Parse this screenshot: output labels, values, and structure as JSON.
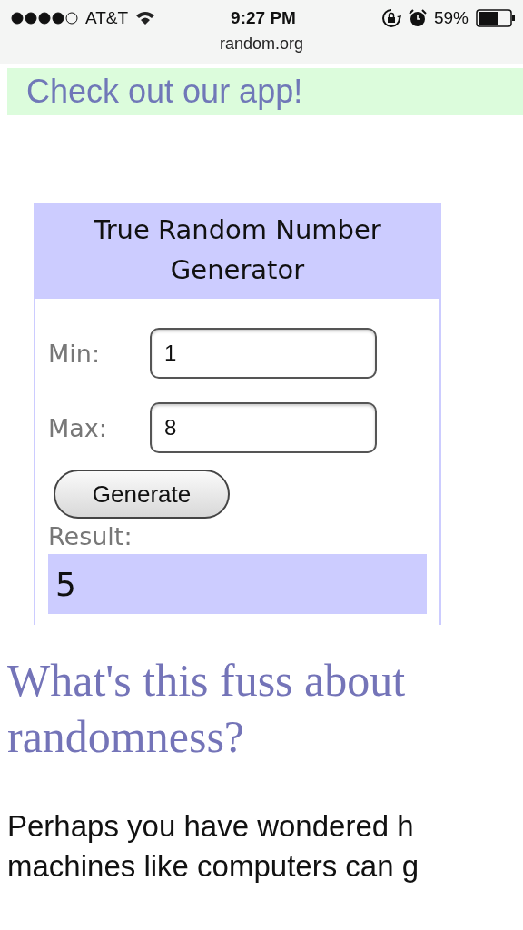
{
  "status_bar": {
    "carrier": "AT&T",
    "time": "9:27 PM",
    "battery": "59%"
  },
  "address_bar": {
    "url": "random.org"
  },
  "banner": {
    "link": "Check out our app!"
  },
  "generator": {
    "title": "True Random Number Generator",
    "fields": [
      {
        "label": "Min:",
        "value": "1"
      },
      {
        "label": "Max:",
        "value": "8"
      }
    ],
    "button": "Generate",
    "result_label": "Result:",
    "result": "5"
  },
  "article": {
    "heading_lines": [
      "What's this fuss about",
      "randomness?"
    ],
    "paragraph_lines": [
      "Perhaps you have wondered h",
      "machines like computers can g"
    ]
  }
}
